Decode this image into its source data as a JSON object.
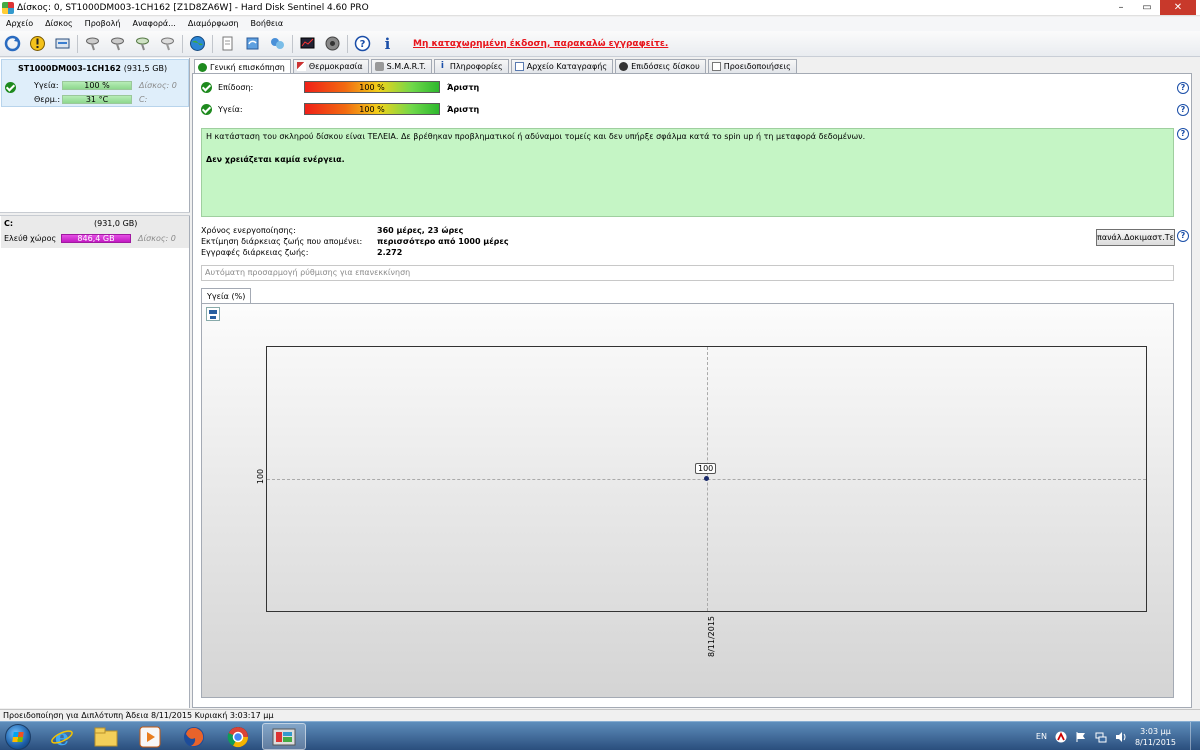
{
  "window": {
    "title": "Δίσκος: 0, ST1000DM003-1CH162 [Z1D8ZA6W]  -  Hard Disk Sentinel 4.60 PRO",
    "minimize": "–",
    "maximize": "▭",
    "close": "✕"
  },
  "menu": [
    "Αρχείο",
    "Δίσκος",
    "Προβολή",
    "Αναφορά...",
    "Διαμόρφωση",
    "Βοήθεια"
  ],
  "toolbar": {
    "warning": "Μη καταχωρημένη έκδοση, παρακαλώ εγγραφείτε."
  },
  "disk": {
    "name": "ST1000DM003-1CH162",
    "size": "(931,5 GB)",
    "health_label": "Υγεία:",
    "health_value": "100 %",
    "health_fraction": 1.0,
    "disk_label": "Δίσκος: 0",
    "temp_label": "Θερμ.:",
    "temp_value": "31 °C",
    "drive_letter": "C:"
  },
  "volume": {
    "letter": "C:",
    "size": "(931,0 GB)",
    "free_label": "Ελεύθ χώρος",
    "free_value": "846,4 GB",
    "disk_label": "Δίσκος: 0"
  },
  "tabs": [
    "Γενική επισκόπηση",
    "Θερμοκρασία",
    "S.M.A.R.T.",
    "Πληροφορίες",
    "Αρχείο Καταγραφής",
    "Επιδόσεις δίσκου",
    "Προειδοποιήσεις"
  ],
  "overview": {
    "performance_label": "Επίδοση:",
    "performance_value": "100 %",
    "performance_rating": "Άριστη",
    "health_label": "Υγεία:",
    "health_value": "100 %",
    "health_rating": "Άριστη",
    "status_text": "Η κατάσταση του σκληρού δίσκου είναι ΤΕΛΕΙΑ. Δε βρέθηκαν προβληματικοί ή αδύναμοι τομείς και δεν υπήρξε σφάλμα κατά το spin up ή τη μεταφορά δεδομένων.",
    "action_text": "Δεν χρειάζεται καμία ενέργεια.",
    "uptime_label": "Χρόνος ενεργοποίησης:",
    "uptime_value": "360 μέρες, 23 ώρες",
    "lifetime_label": "Εκτίμηση διάρκειας ζωής που απομένει:",
    "lifetime_value": "περισσότερο από 1000 μέρες",
    "writes_label": "Εγγραφές διάρκειας ζωής:",
    "writes_value": "2.272",
    "test_button": "πανάλ.Δοκιμαστ.Τεσ",
    "auto_placeholder": "Αυτόματη προσαρμογή ρύθμισης για επανεκκίνηση"
  },
  "graph_tab": "Υγεία (%)",
  "chart_data": {
    "type": "line",
    "x": [
      "8/11/2015"
    ],
    "series": [
      {
        "values": [
          100
        ]
      }
    ],
    "ytick": "100",
    "point_label": "100"
  },
  "statusbar": {
    "text": "Προειδοποίηση για Διπλότυπη  Άδεια 8/11/2015 Κυριακή 3:03:17 μμ"
  },
  "taskbar": {
    "lang": "EN",
    "time": "3:03 μμ",
    "date": "8/11/2015"
  }
}
